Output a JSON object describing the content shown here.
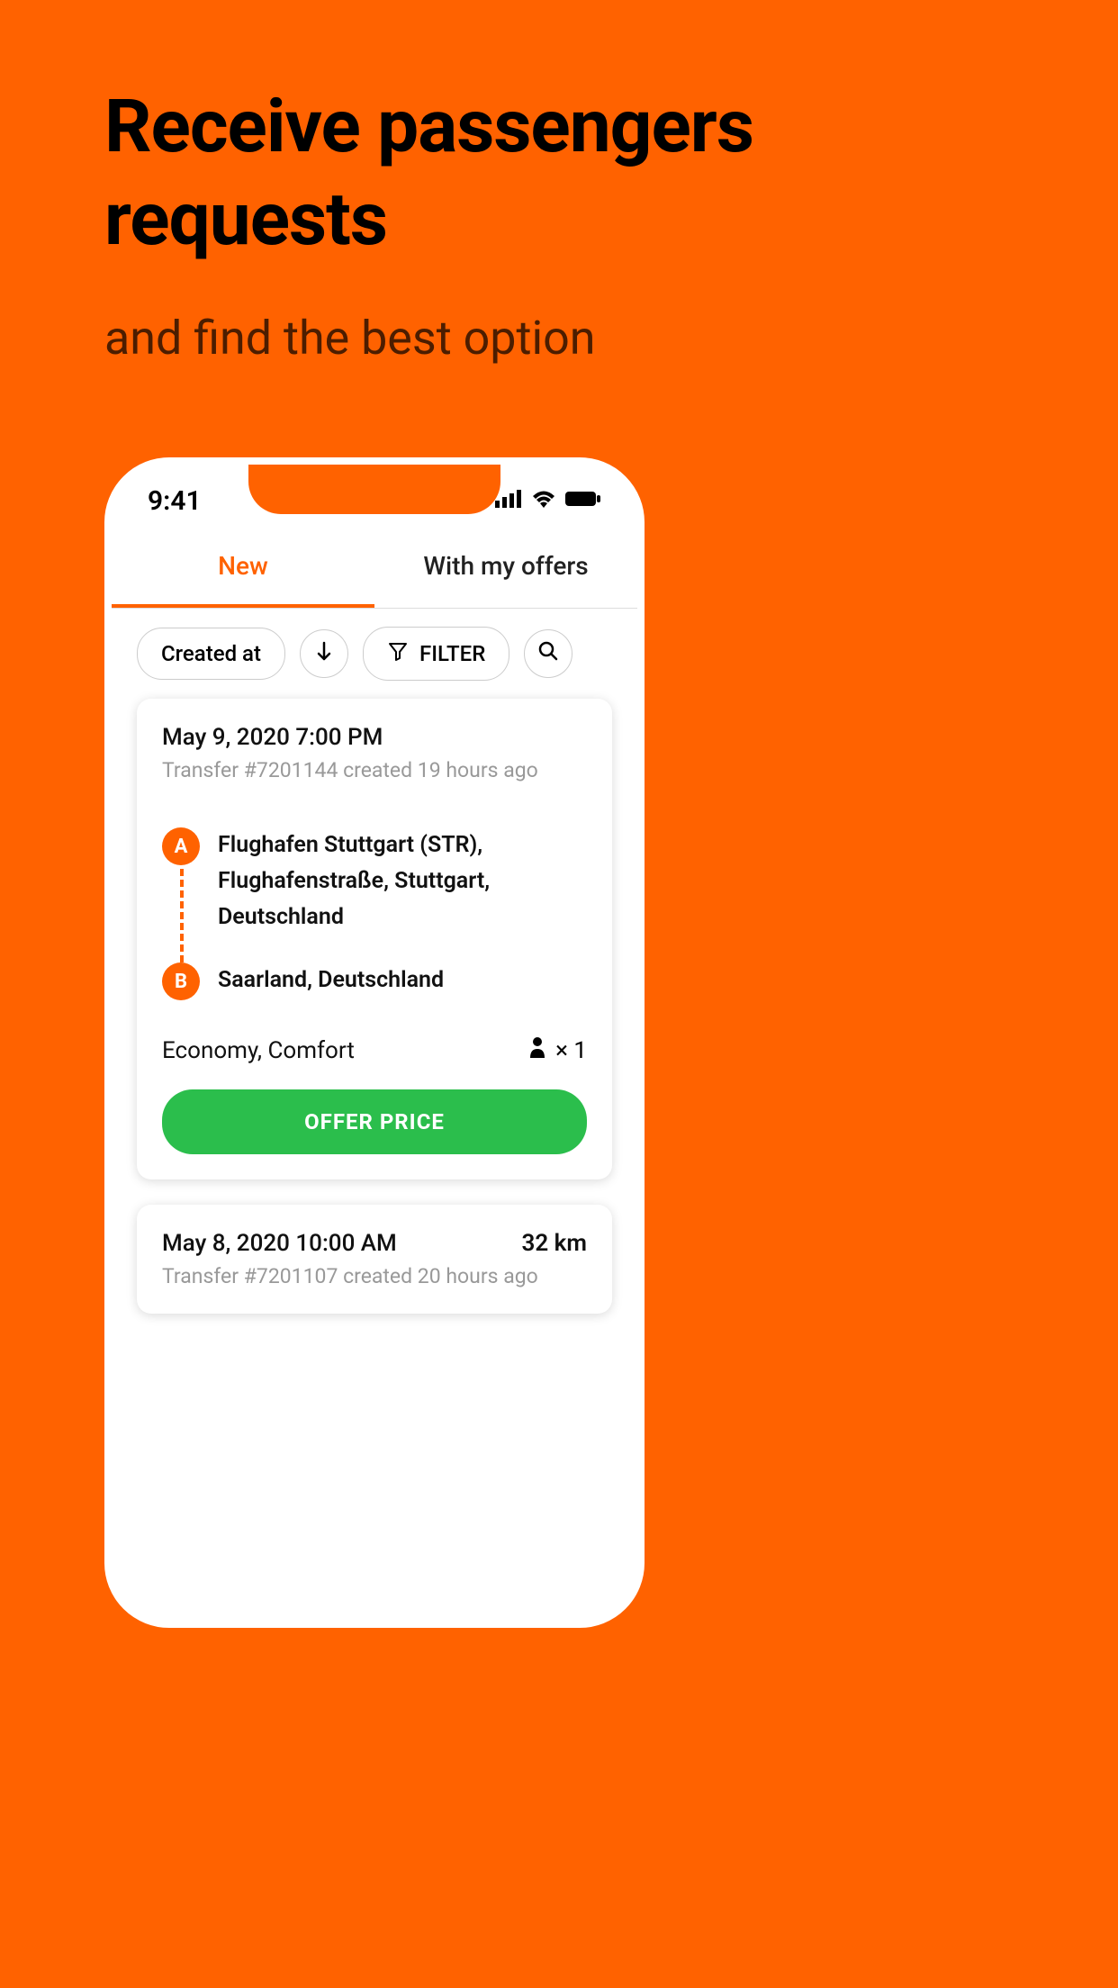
{
  "marketing": {
    "headline": "Receive passengers requests",
    "subheadline": "and find the best option"
  },
  "status": {
    "time": "9:41"
  },
  "tabs": {
    "new": "New",
    "offers": "With my offers"
  },
  "filter_bar": {
    "sort_label": "Created at",
    "filter_label": "FILTER"
  },
  "cards": [
    {
      "date": "May 9, 2020 7:00 PM",
      "sub": "Transfer #7201144 created 19 hours ago",
      "point_a_label": "A",
      "point_a_text": "Flughafen Stuttgart (STR), Flughafenstraße, Stuttgart, Deutschland",
      "point_b_label": "B",
      "point_b_text": "Saarland, Deutschland",
      "vehicle": "Economy, Comfort",
      "pax": "× 1",
      "offer_button": "OFFER PRICE"
    },
    {
      "date": "May 8, 2020 10:00 AM",
      "distance": "32 km",
      "sub": "Transfer #7201107 created 20 hours ago"
    }
  ]
}
